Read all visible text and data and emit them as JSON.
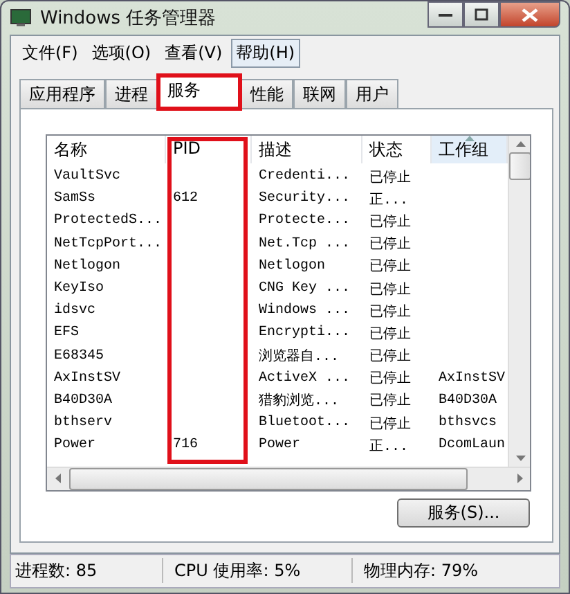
{
  "window": {
    "title": "Windows 任务管理器"
  },
  "menu": [
    {
      "label": "文件(F)",
      "selected": false
    },
    {
      "label": "选项(O)",
      "selected": false
    },
    {
      "label": "查看(V)",
      "selected": false
    },
    {
      "label": "帮助(H)",
      "selected": true
    }
  ],
  "tabs": [
    {
      "label": "应用程序",
      "selected": false,
      "highlighted": false
    },
    {
      "label": "进程",
      "selected": false,
      "highlighted": false
    },
    {
      "label": "服务",
      "selected": true,
      "highlighted": true
    },
    {
      "label": "性能",
      "selected": false,
      "highlighted": false
    },
    {
      "label": "联网",
      "selected": false,
      "highlighted": false
    },
    {
      "label": "用户",
      "selected": false,
      "highlighted": false
    }
  ],
  "table": {
    "columns": [
      {
        "label": "名称",
        "sorted": false,
        "highlighted": false
      },
      {
        "label": "PID",
        "sorted": false,
        "highlighted": true
      },
      {
        "label": "描述",
        "sorted": false,
        "highlighted": false
      },
      {
        "label": "状态",
        "sorted": false,
        "highlighted": false
      },
      {
        "label": "工作组",
        "sorted": true,
        "highlighted": false
      }
    ],
    "rows": [
      [
        "VaultSvc",
        "",
        "Credenti...",
        "已停止",
        ""
      ],
      [
        "SamSs",
        "612",
        "Security...",
        "正...",
        ""
      ],
      [
        "ProtectedS...",
        "",
        "Protecte...",
        "已停止",
        ""
      ],
      [
        "NetTcpPort...",
        "",
        "Net.Tcp ...",
        "已停止",
        ""
      ],
      [
        "Netlogon",
        "",
        "Netlogon",
        "已停止",
        ""
      ],
      [
        "KeyIso",
        "",
        "CNG Key ...",
        "已停止",
        ""
      ],
      [
        "idsvc",
        "",
        "Windows ...",
        "已停止",
        ""
      ],
      [
        "EFS",
        "",
        "Encrypti...",
        "已停止",
        ""
      ],
      [
        "E68345",
        "",
        "浏览器自...",
        "已停止",
        ""
      ],
      [
        "AxInstSV",
        "",
        "ActiveX ...",
        "已停止",
        "AxInstSV"
      ],
      [
        "B40D30A",
        "",
        "猎豹浏览...",
        "已停止",
        "B40D30A"
      ],
      [
        "bthserv",
        "",
        "Bluetoot...",
        "已停止",
        "bthsvcs"
      ],
      [
        "Power",
        "716",
        "Power",
        "正...",
        "DcomLaun"
      ]
    ]
  },
  "services_button": "服务(S)...",
  "status_bar": [
    "进程数: 85",
    "CPU 使用率: 5%",
    "物理内存: 79%"
  ]
}
